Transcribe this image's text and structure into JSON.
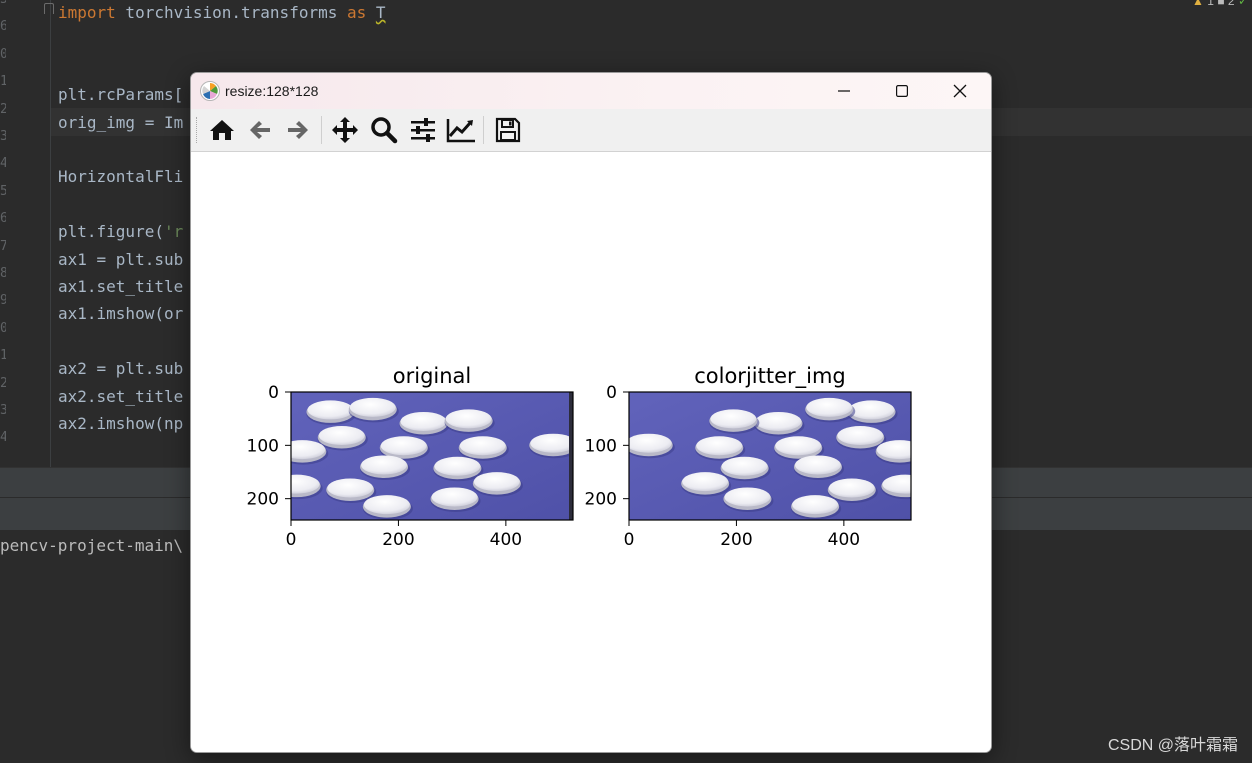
{
  "editor": {
    "code_lines": [
      {
        "parts": [
          {
            "t": "import",
            "c": "kw"
          },
          {
            "t": " torchvision.transforms "
          },
          {
            "t": "as",
            "c": "kw"
          },
          {
            "t": " "
          },
          {
            "t": "T",
            "c": "warn"
          }
        ]
      },
      {
        "parts": []
      },
      {
        "parts": []
      },
      {
        "parts": [
          {
            "t": "plt.rcParams["
          }
        ]
      },
      {
        "parts": [
          {
            "t": "orig_img = Im"
          }
        ]
      },
      {
        "parts": []
      },
      {
        "parts": [
          {
            "t": "HorizontalFli"
          }
        ]
      },
      {
        "parts": []
      },
      {
        "parts": [
          {
            "t": "plt.figure("
          },
          {
            "t": "'r",
            "c": "str"
          }
        ]
      },
      {
        "parts": [
          {
            "t": "ax1 = plt.sub"
          }
        ]
      },
      {
        "parts": [
          {
            "t": "ax1.set_title"
          }
        ]
      },
      {
        "parts": [
          {
            "t": "ax1.imshow(or"
          }
        ]
      },
      {
        "parts": []
      },
      {
        "parts": [
          {
            "t": "ax2 = plt.sub"
          }
        ]
      },
      {
        "parts": [
          {
            "t": "ax2.set_title"
          }
        ]
      },
      {
        "parts": [
          {
            "t": "ax2.imshow(np"
          }
        ]
      }
    ],
    "line_numbers": [
      "5",
      "6",
      "0",
      "1",
      "2",
      "3",
      "4",
      "5",
      "6",
      "7",
      "8",
      "9",
      "0",
      "1",
      "2",
      "3",
      "4"
    ],
    "inspection": {
      "warnings": "1",
      "weak": "2"
    }
  },
  "terminal": {
    "path_fragment": "pencv-project-main\\"
  },
  "watermark": "CSDN @落叶霜霜",
  "window": {
    "title": "resize:128*128",
    "controls": {
      "minimize": "minimize-icon",
      "maximize": "maximize-icon",
      "close": "close-icon"
    },
    "toolbar": [
      "home-icon",
      "back-arrow-icon",
      "forward-arrow-icon",
      "pan-icon",
      "zoom-icon",
      "subplots-config-icon",
      "edit-axis-icon",
      "save-icon"
    ]
  },
  "chart_data": [
    {
      "type": "image",
      "title": "original",
      "xticks": [
        0,
        200,
        400
      ],
      "yticks": [
        0,
        100,
        200
      ],
      "xlim": [
        0,
        525
      ],
      "ylim": [
        240,
        0
      ],
      "background_color": "#5d5fb8",
      "content": "white pills on blue-purple background"
    },
    {
      "type": "image",
      "title": "colorjitter_img",
      "xticks": [
        0,
        200,
        400
      ],
      "yticks": [
        0,
        100,
        200
      ],
      "xlim": [
        0,
        525
      ],
      "ylim": [
        240,
        0
      ],
      "background_color": "#5d5fb8",
      "content": "white pills on blue-purple background (horizontally flipped)"
    }
  ]
}
